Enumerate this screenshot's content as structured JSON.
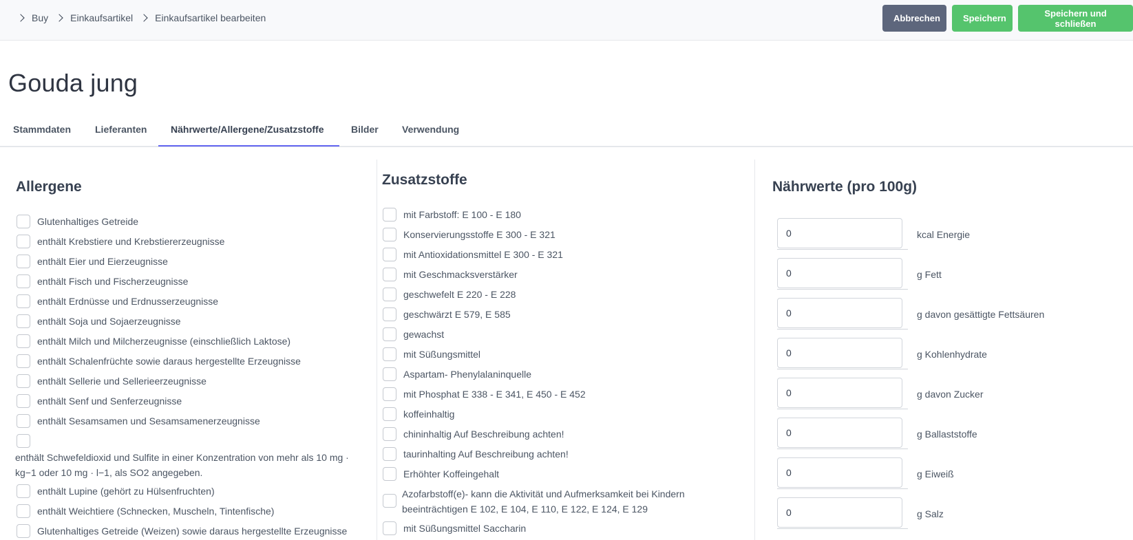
{
  "breadcrumb": [
    "Buy",
    "Einkaufsartikel",
    "Einkaufsartikel bearbeiten"
  ],
  "actions": {
    "cancel": "Abbrechen",
    "save": "Speichern",
    "save_close": "Speichern und schließen"
  },
  "colors": {
    "cancel": "#5d667c",
    "save": "#55c46d",
    "tab_active": "#6366f1"
  },
  "title": "Gouda jung",
  "tabs": [
    "Stammdaten",
    "Lieferanten",
    "Nährwerte/Allergene/Zusatzstoffe",
    "Bilder",
    "Verwendung"
  ],
  "active_tab": "Nährwerte/Allergene/Zusatzstoffe",
  "allergens": {
    "title": "Allergene",
    "items": [
      "Glutenhaltiges Getreide",
      "enthält Krebstiere und Krebstiererzeugnisse",
      "enthält Eier und Eierzeugnisse",
      "enthält Fisch und Fischerzeugnisse",
      "enthält Erdnüsse und Erdnusserzeugnisse",
      "enthält Soja und Sojaerzeugnisse",
      "enthält Milch und Milcherzeugnisse (einschließlich Laktose)",
      "enthält Schalenfrüchte sowie daraus hergestellte Erzeugnisse",
      "enthält Sellerie und Sellerieerzeugnisse",
      "enthält Senf und Senferzeugnisse",
      "enthält Sesamsamen und Sesamsamenerzeugnisse"
    ],
    "sulfite_line1": "enthält Schwefeldioxid und Sulfite in einer Konzentration von mehr als 10 mg ·",
    "sulfite_line2": "kg−1 oder 10 mg · l−1, als SO2 angegeben.",
    "items_after": [
      "enthält Lupine (gehört zu Hülsenfruchten)",
      "enthält Weichtiere (Schnecken, Muscheln, Tintenfische)",
      "Glutenhaltiges Getreide (Weizen) sowie daraus hergestellte Erzeugnisse"
    ]
  },
  "additives": {
    "title": "Zusatzstoffe",
    "items": [
      "mit Farbstoff: E 100 - E 180",
      "Konservierungsstoffe E 300 - E 321",
      "mit Antioxidationsmittel E 300 - E 321",
      "mit Geschmacksverstärker",
      "geschwefelt E 220 - E 228",
      "geschwärzt E 579, E 585",
      "gewachst",
      "mit Süßungsmittel",
      "Aspartam- Phenylalaninquelle",
      "mit Phosphat E 338 - E 341, E 450 - E 452",
      "koffeinhaltig",
      "chininhaltig Auf Beschreibung achten!",
      "taurinhalting Auf Beschreibung achten!",
      "Erhöhter Koffeingehalt"
    ],
    "azo_line1": "Azofarbstoff(e)- kann die Aktivität und Aufmerksamkeit bei Kindern",
    "azo_line2": "beeinträchtigen E 102, E 104, E 110, E 122, E 124, E 129",
    "last_item": "mit Süßungsmittel Saccharin"
  },
  "nutrition": {
    "title": "Nährwerte (pro 100g)",
    "rows": [
      {
        "value": "0",
        "label": "kcal Energie"
      },
      {
        "value": "0",
        "label": "g Fett"
      },
      {
        "value": "0",
        "label": "g davon gesättigte Fettsäuren"
      },
      {
        "value": "0",
        "label": "g Kohlenhydrate"
      },
      {
        "value": "0",
        "label": "g davon Zucker"
      },
      {
        "value": "0",
        "label": "g Ballaststoffe"
      },
      {
        "value": "0",
        "label": "g Eiweiß"
      },
      {
        "value": "0",
        "label": "g Salz"
      }
    ]
  }
}
